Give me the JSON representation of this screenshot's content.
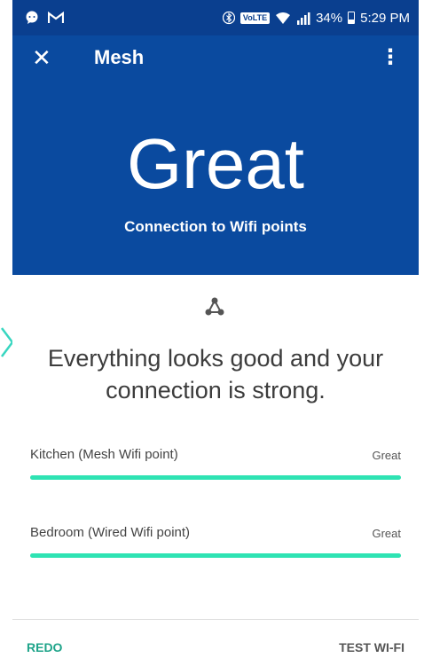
{
  "status_bar": {
    "icons_left": [
      "chat-bubble-icon",
      "gmail-icon"
    ],
    "icons_right": [
      "bluetooth-icon",
      "volte-badge",
      "wifi-icon",
      "signal-icon",
      "battery-icon"
    ],
    "volte": "VoLTE",
    "battery": "34%",
    "time": "5:29 PM"
  },
  "header": {
    "title": "Mesh",
    "rating": "Great",
    "subtitle": "Connection to Wifi points",
    "background": "#0a4a9f"
  },
  "main": {
    "icon": "mesh-network-icon",
    "headline": "Everything looks good and your connection is strong.",
    "points": [
      {
        "name": "Kitchen (Mesh Wifi point)",
        "status": "Great",
        "level": 1.0
      },
      {
        "name": "Bedroom (Wired Wifi point)",
        "status": "Great",
        "level": 1.0
      }
    ],
    "bar_color": "#2ee3b3"
  },
  "footer": {
    "redo_label": "REDO",
    "test_label": "TEST WI-FI",
    "accent": "#1fa48a"
  }
}
